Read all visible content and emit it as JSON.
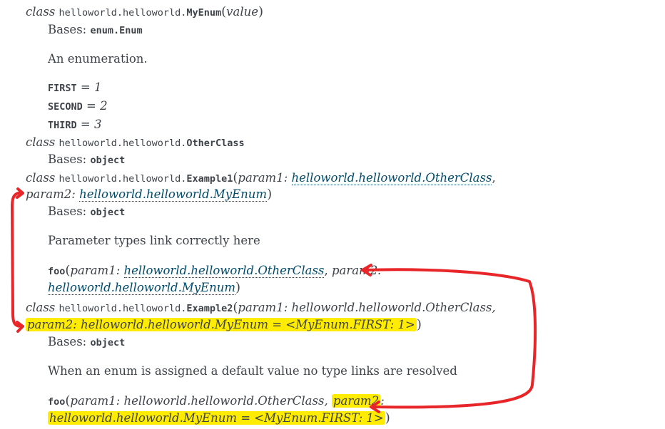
{
  "kw": {
    "class": "class"
  },
  "enum": {
    "module": "helloworld.helloworld.",
    "name": "MyEnum",
    "args": "value",
    "bases_label": "Bases: ",
    "bases_value": "enum.Enum",
    "desc": "An enumeration.",
    "members": [
      {
        "name": "FIRST",
        "eq": " = ",
        "value": "1"
      },
      {
        "name": "SECOND",
        "eq": " = ",
        "value": "2"
      },
      {
        "name": "THIRD",
        "eq": " = ",
        "value": "3"
      }
    ]
  },
  "other": {
    "module": "helloworld.helloworld.",
    "name": "OtherClass",
    "bases_label": "Bases: ",
    "bases_value": "object"
  },
  "ex1": {
    "module": "helloworld.helloworld.",
    "name": "Example1",
    "p1": "param1: ",
    "p1_type": "helloworld.helloworld.OtherClass",
    "comma": ",",
    "p2": "param2: ",
    "p2_type": "helloworld.helloworld.MyEnum",
    "bases_label": "Bases: ",
    "bases_value": "object",
    "desc": "Parameter types link correctly here",
    "method": {
      "name": "foo",
      "p1": "param1: ",
      "p1_type": "helloworld.helloworld.OtherClass",
      "comma": ", ",
      "p2": "param2:",
      "p2_type": "helloworld.helloworld.MyEnum"
    }
  },
  "ex2": {
    "module": "helloworld.helloworld.",
    "name": "Example2",
    "sig1": "param1: helloworld.helloworld.OtherClass,",
    "sig2": "param2: helloworld.helloworld.MyEnum = <MyEnum.FIRST: 1>",
    "bases_label": "Bases: ",
    "bases_value": "object",
    "desc": "When an enum is assigned a default value no type links are resolved",
    "method": {
      "name": "foo",
      "sig1": "param1: helloworld.helloworld.OtherClass, ",
      "p2_hl": "param2",
      "colon": ":",
      "sig2": "helloworld.helloworld.MyEnum = <MyEnum.FIRST: 1>"
    }
  },
  "paren_open": "(",
  "paren_close": ")",
  "colors": {
    "annotation": "#e8262a",
    "highlight": "#ffec00",
    "link": "#004b6b"
  }
}
